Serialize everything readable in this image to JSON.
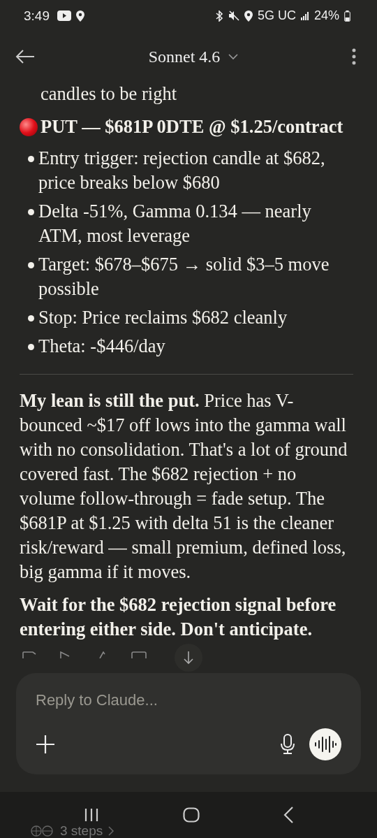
{
  "status_bar": {
    "time": "3:49",
    "network": "5G UC",
    "battery": "24%"
  },
  "header": {
    "title": "Sonnet 4.6"
  },
  "message": {
    "continued_text": "candles to be right",
    "heading": "PUT — $681P 0DTE @ $1.25/contract",
    "bullets": [
      "Entry trigger: rejection candle at $682, price breaks below $680",
      "Delta -51%, Gamma 0.134 — nearly ATM, most leverage",
      "Target: $678–$675 → solid $3–5 move possible",
      "Stop: Price reclaims $682 cleanly",
      "Theta: -$446/day"
    ],
    "paragraphs": [
      "**My lean is still the put.** Price has V-bounced ~$17 off lows into the gamma wall with no consolidation. That's a lot of ground covered fast. The $682 rejection + no volume follow-through = fade setup. The $681P at $1.25 with delta 51 is the cleaner risk/reward — small premium, defined loss, big gamma if it moves.",
      "**Wait for the $682 rejection signal before entering either side. Don't anticipate.**"
    ]
  },
  "composer": {
    "placeholder": "Reply to Claude..."
  },
  "footer": {
    "steps": "3 steps"
  }
}
